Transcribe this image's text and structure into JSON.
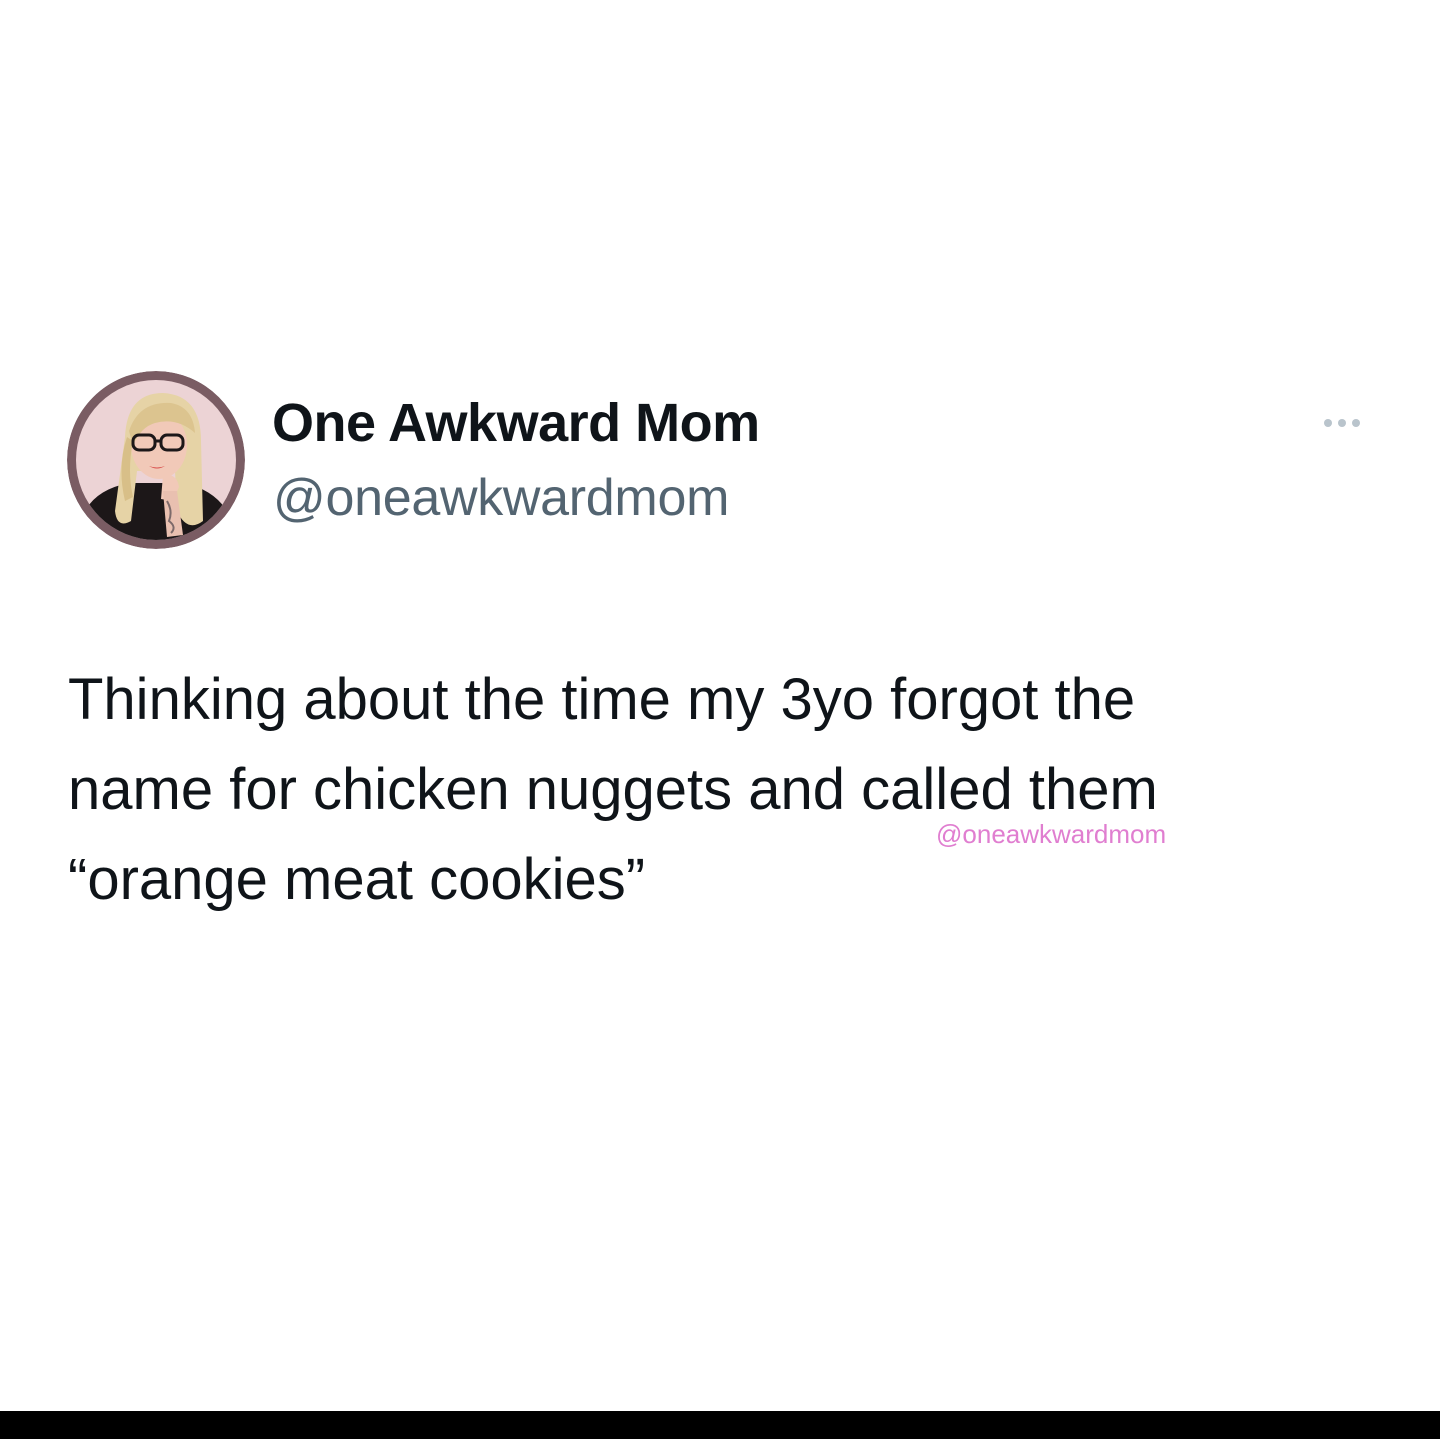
{
  "tweet": {
    "display_name": "One Awkward Mom",
    "handle": "@oneawkwardmom",
    "avatar_icon": "avatar-illustration",
    "more_icon": "more-dots-icon",
    "text_lines": [
      "Thinking about the time my 3yo forgot the",
      "name for chicken nuggets and called them",
      "“orange meat cookies”"
    ],
    "watermark": "@oneawkwardmom"
  },
  "colors": {
    "name": "#0f1419",
    "handle": "#536471",
    "watermark": "#e07ed0",
    "avatar_ring": "#7a5c63",
    "avatar_bg": "#ecd3d5",
    "bottom_bar": "#000000"
  }
}
